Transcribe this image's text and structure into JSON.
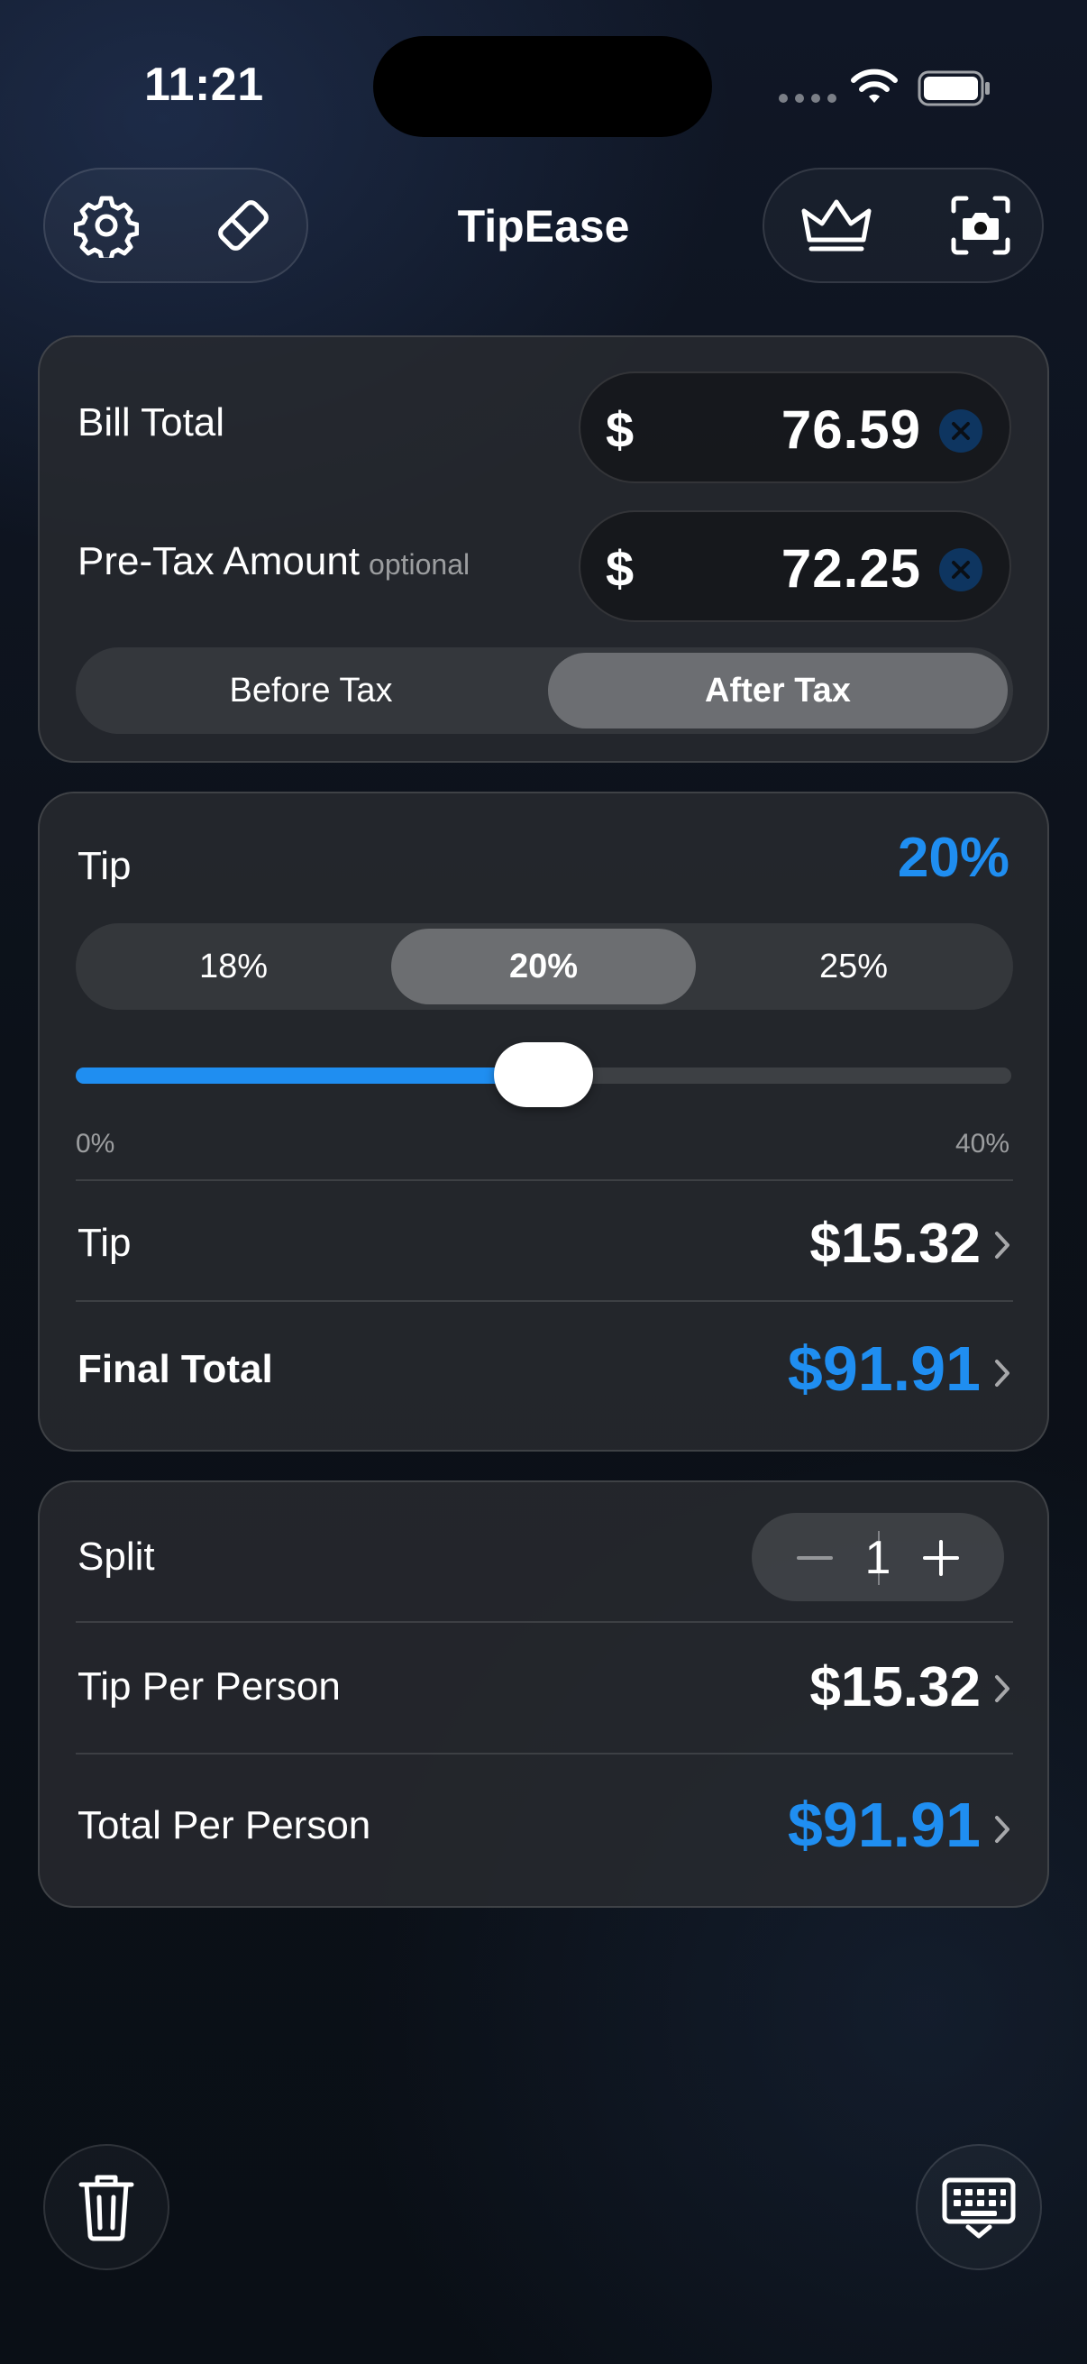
{
  "status_bar": {
    "time": "11:21"
  },
  "header": {
    "title": "TipEase",
    "left_icons": [
      "gear-icon",
      "eraser-icon"
    ],
    "right_icons": [
      "crown-icon",
      "camera-scan-icon"
    ]
  },
  "bill": {
    "bill_total_label": "Bill Total",
    "bill_total_currency": "$",
    "bill_total_value": "76.59",
    "pretax_label": "Pre-Tax Amount",
    "pretax_optional": "optional",
    "pretax_currency": "$",
    "pretax_value": "72.25",
    "tax_mode_options": [
      "Before Tax",
      "After Tax"
    ],
    "tax_mode_selected": "After Tax"
  },
  "tip": {
    "label": "Tip",
    "percent_display": "20%",
    "presets": [
      "18%",
      "20%",
      "25%"
    ],
    "preset_selected": "20%",
    "slider_min_label": "0%",
    "slider_max_label": "40%",
    "slider_value_percent": 20,
    "slider_max_percent": 40,
    "tip_amount_label": "Tip",
    "tip_amount_value": "$15.32",
    "final_total_label": "Final Total",
    "final_total_value": "$91.91"
  },
  "split": {
    "label": "Split",
    "count": "1",
    "tip_per_person_label": "Tip Per Person",
    "tip_per_person_value": "$15.32",
    "total_per_person_label": "Total Per Person",
    "total_per_person_value": "$91.91"
  },
  "bottom": {
    "left_icon": "trash-icon",
    "right_icon": "keyboard-dismiss-icon"
  },
  "colors": {
    "accent": "#1f8ef1",
    "clear_button": "#0e3560"
  }
}
